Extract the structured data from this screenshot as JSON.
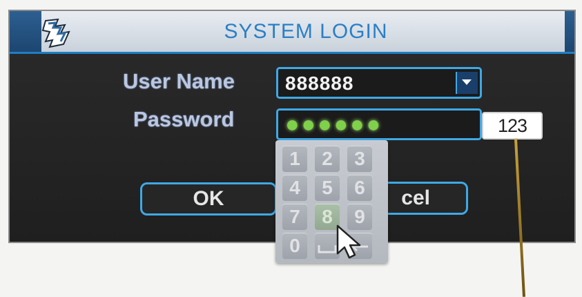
{
  "dialog": {
    "title": "SYSTEM LOGIN",
    "username_label": "User Name",
    "username_value": "888888",
    "password_label": "Password",
    "password_mask": "●●●●●●",
    "keyboard_toggle": "123",
    "ok_label": "OK",
    "cancel_label": "Cancel",
    "cancel_visible_fragment": "cel"
  },
  "keypad": {
    "keys": [
      "1",
      "2",
      "3",
      "4",
      "5",
      "6",
      "7",
      "8",
      "9",
      "0"
    ],
    "active_key": "8"
  },
  "colors": {
    "accent": "#3fa9e6",
    "title_text": "#2b7fc5",
    "password_dots": "#7fd04a"
  }
}
